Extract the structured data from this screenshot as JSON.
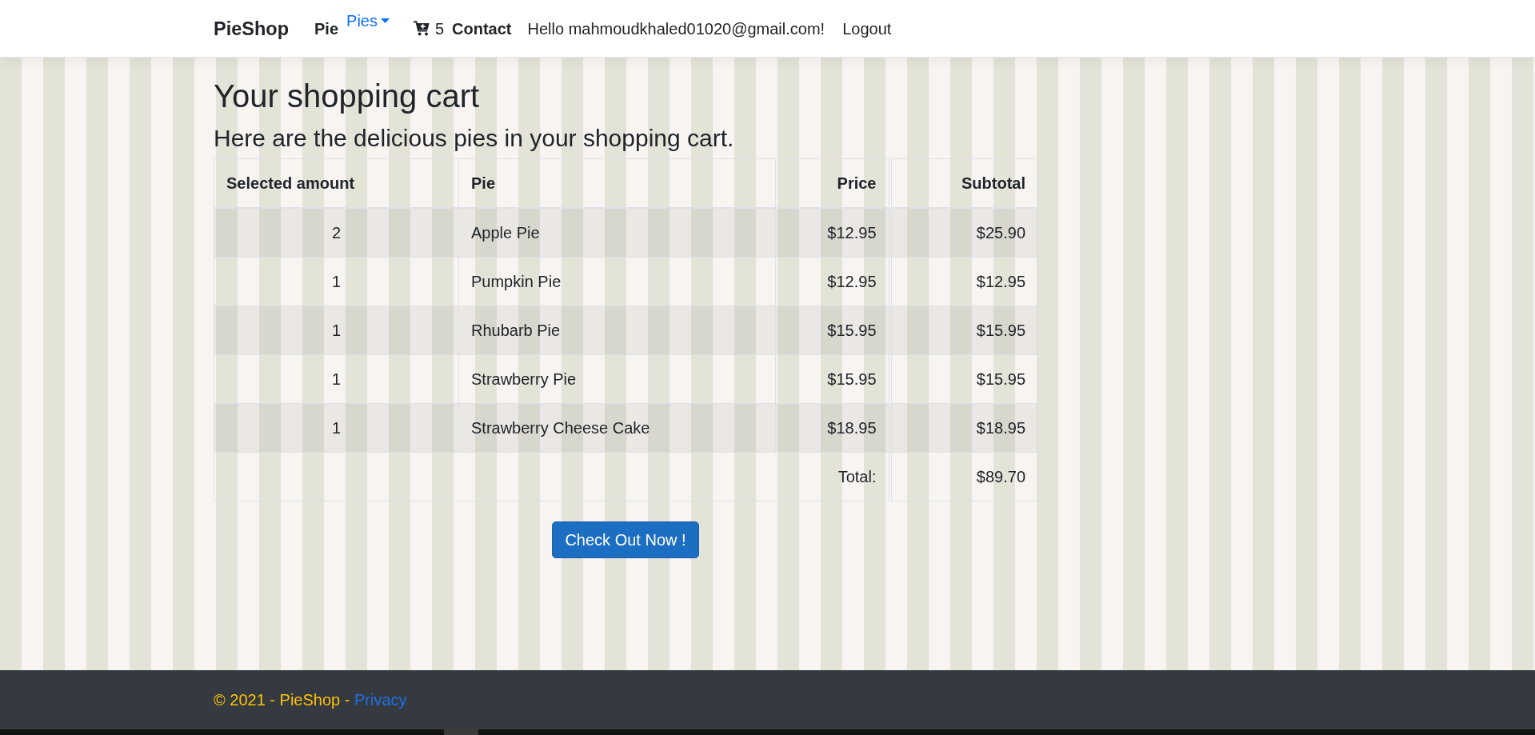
{
  "navbar": {
    "brand": "PieShop",
    "items": [
      {
        "kind": "link",
        "label": "Pie"
      },
      {
        "kind": "dropdown",
        "label": "Pies"
      },
      {
        "kind": "cart",
        "count": "5"
      },
      {
        "kind": "link",
        "label": "Contact"
      }
    ],
    "greeting": "Hello mahmoudkhaled01020@gmail.com!",
    "logout": "Logout"
  },
  "page": {
    "title": "Your shopping cart",
    "subtitle": "Here are the delicious pies in your shopping cart."
  },
  "cart_table": {
    "columns": [
      "Selected amount",
      "Pie",
      "Price",
      "Subtotal"
    ],
    "rows": [
      {
        "amount": "2",
        "pie": "Apple Pie",
        "price": "$12.95",
        "subtotal": "$25.90"
      },
      {
        "amount": "1",
        "pie": "Pumpkin Pie",
        "price": "$12.95",
        "subtotal": "$12.95"
      },
      {
        "amount": "1",
        "pie": "Rhubarb Pie",
        "price": "$15.95",
        "subtotal": "$15.95"
      },
      {
        "amount": "1",
        "pie": "Strawberry Pie",
        "price": "$15.95",
        "subtotal": "$15.95"
      },
      {
        "amount": "1",
        "pie": "Strawberry Cheese Cake",
        "price": "$18.95",
        "subtotal": "$18.95"
      }
    ],
    "total": {
      "label": "Total:",
      "value": "$89.70"
    }
  },
  "checkout_button": "Check Out Now !",
  "footer": {
    "copyright": "© 2021 - PieShop -",
    "link": "Privacy"
  }
}
